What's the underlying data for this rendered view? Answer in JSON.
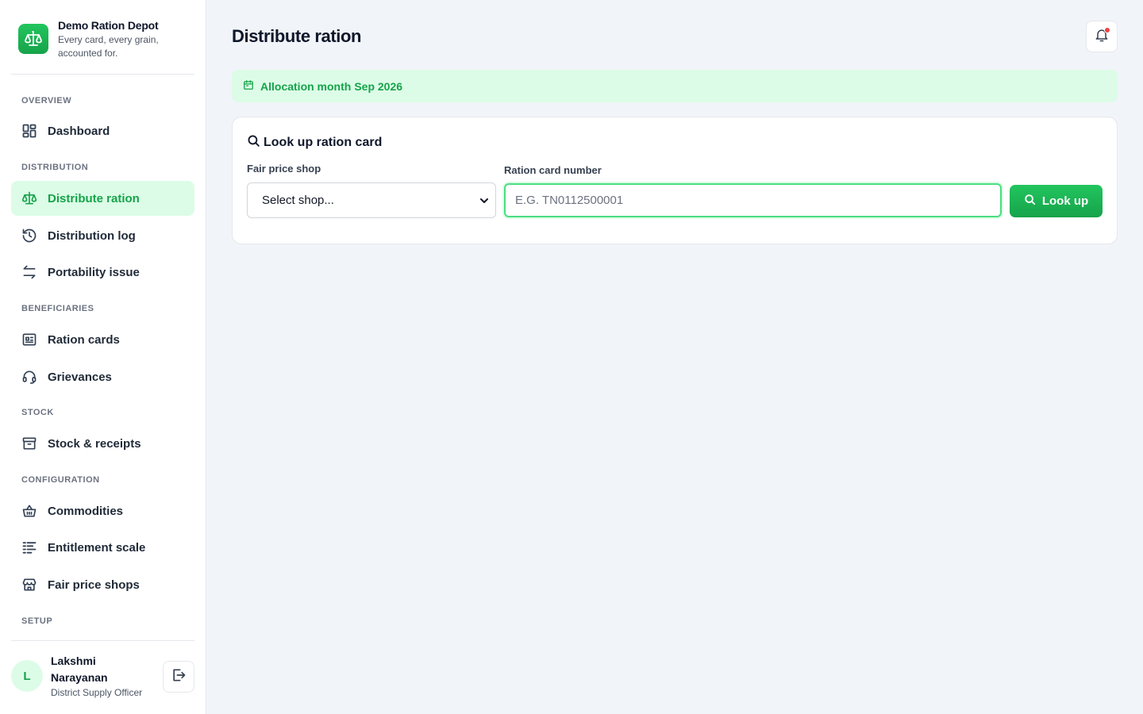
{
  "brand": {
    "name": "Demo Ration Depot",
    "tagline": "Every card, every grain, accounted for."
  },
  "sidebar": {
    "sections": {
      "overview": "OVERVIEW",
      "distribution": "DISTRIBUTION",
      "beneficiaries": "BENEFICIARIES",
      "stock": "STOCK",
      "configuration": "CONFIGURATION",
      "setup": "SETUP"
    },
    "items": {
      "dashboard": "Dashboard",
      "distribute": "Distribute ration",
      "log": "Distribution log",
      "portability": "Portability issue",
      "cards": "Ration cards",
      "grievances": "Grievances",
      "stock": "Stock & receipts",
      "commodities": "Commodities",
      "entitlement": "Entitlement scale",
      "shops": "Fair price shops"
    },
    "active": "Distribute ration"
  },
  "user": {
    "initial": "L",
    "name": "Lakshmi Narayanan",
    "role": "District Supply Officer"
  },
  "page": {
    "title": "Distribute ration"
  },
  "banner": {
    "label": "Allocation month",
    "month": "Sep 2026"
  },
  "lookup": {
    "title": "Look up ration card",
    "shop_label": "Fair price shop",
    "shop_selected": "Select shop...",
    "card_label": "Ration card number",
    "card_placeholder": "E.G. TN0112500001",
    "card_value": "",
    "button": "Look up"
  },
  "colors": {
    "accent": "#16a34a",
    "accent_light": "#dcfce7",
    "notification_dot": "#ef4444",
    "background": "#f1f4f9"
  }
}
